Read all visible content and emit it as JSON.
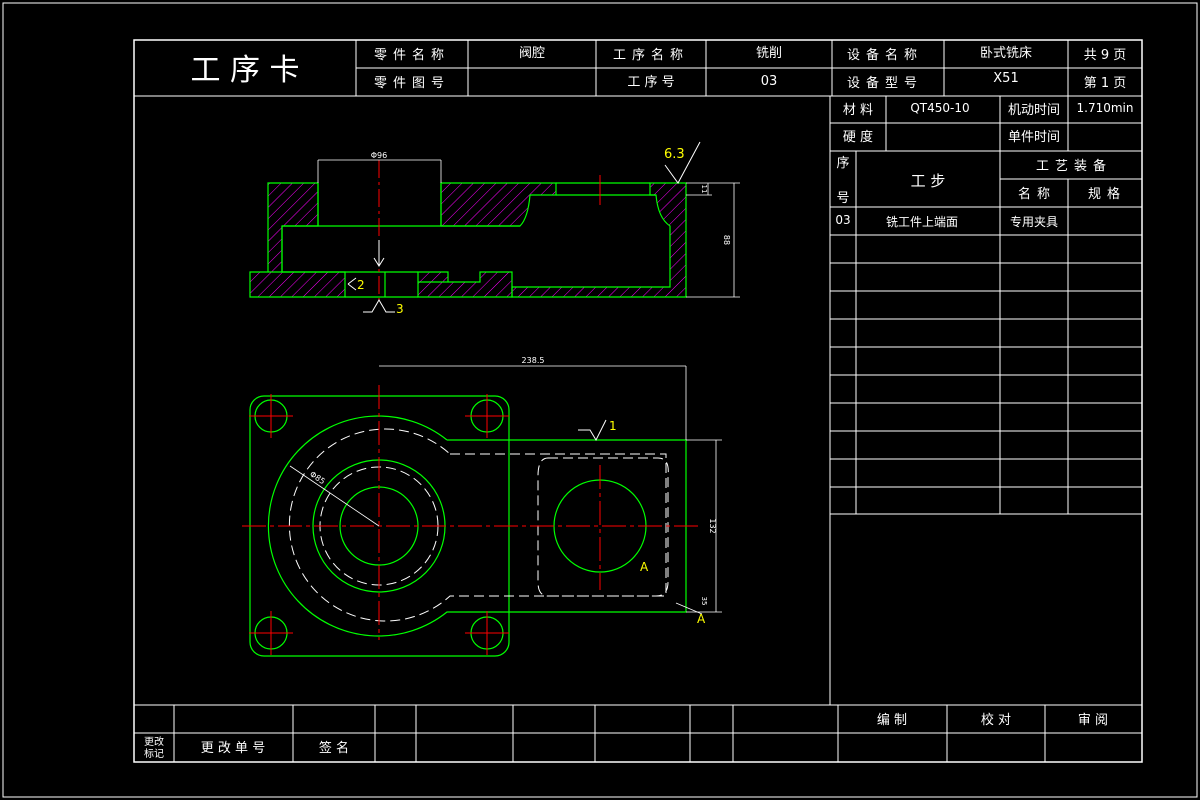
{
  "header": {
    "title": "工  序  卡",
    "part_name_label": "零件名称",
    "part_name_value": "阀腔",
    "part_drawing_label": "零件图号",
    "part_drawing_value": "",
    "process_name_label": "工序名称",
    "process_name_value": "铣削",
    "process_no_label": "工  序  号",
    "process_no_value": "03",
    "equip_name_label": "设备名称",
    "equip_name_value": "卧式铣床",
    "equip_model_label": "设备型号",
    "equip_model_value": "X51",
    "total_pages": "共 9 页",
    "page_no": "第 1 页"
  },
  "info": {
    "material_label": "材  料",
    "material_value": "QT450-10",
    "machine_time_label": "机动时间",
    "machine_time_value": "1.710min",
    "hardness_label": "硬  度",
    "hardness_value": "",
    "unit_time_label": "单件时间",
    "unit_time_value": ""
  },
  "steps_table": {
    "seq_label_top": "序",
    "seq_label_bottom": "号",
    "step_label": "工    步",
    "equipment_label": "工艺装备",
    "name_label": "名称",
    "spec_label": "规格",
    "rows": [
      {
        "seq": "03",
        "step": "铣工件上端面",
        "name": "专用夹具",
        "spec": ""
      }
    ]
  },
  "footer": {
    "change_mark_label_1": "更改",
    "change_mark_label_2": "标记",
    "change_no_label": "更 改 单 号",
    "sign_label": "签  名",
    "compile_label": "编    制",
    "check_label": "校    对",
    "review_label": "审    阅"
  },
  "drawing": {
    "dim_top_width": "Φ96",
    "dim_height": "88",
    "dim_small": "11",
    "roughness_top": "6.3",
    "mark_2": "2",
    "mark_3": "3",
    "dim_length": "238.5",
    "dim_dia": "Φ85",
    "dim_width": "132",
    "dim_small_bottom": "35",
    "roughness_1": "1",
    "mark_a": "A",
    "mark_a2": "A"
  },
  "colors": {
    "frame": "#ffffff",
    "outline": "#00ff00",
    "center_line": "#ff0000",
    "hatch": "#ff00ff",
    "dimension": "#ffffff",
    "annotation": "#ffff00"
  }
}
